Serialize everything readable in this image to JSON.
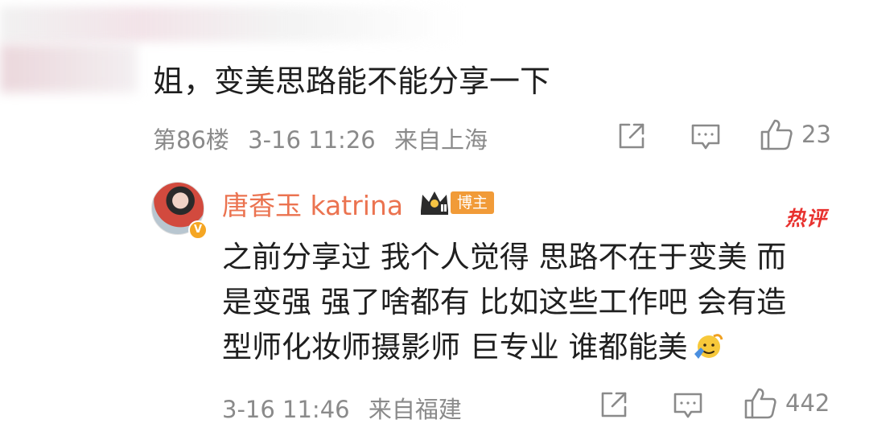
{
  "comment": {
    "text": "姐，变美思路能不能分享一下",
    "floor": "第86楼",
    "time": "3-16 11:26",
    "location": "来自上海",
    "likes": "23"
  },
  "reply": {
    "author": "唐香玉 katrina",
    "badge": "博主",
    "hot_tag": "热评",
    "lines": [
      "之前分享过 我个人觉得 思路不在于变美 而",
      "是变强 强了啥都有 比如这些工作吧 会有造",
      "型师化妆师摄影师 巨专业 谁都能美"
    ],
    "time": "3-16 11:46",
    "location": "来自福建",
    "likes": "442"
  },
  "icons": {
    "share": "share-icon",
    "comment": "comment-icon",
    "like": "thumbs-up-icon"
  },
  "colors": {
    "author_name": "#eb7350",
    "meta": "#8a8a8a",
    "hot": "#e8312e",
    "badge": "#f19b38"
  }
}
